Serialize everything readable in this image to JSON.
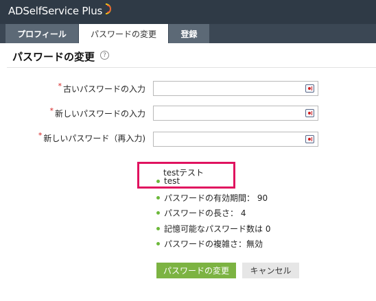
{
  "header": {
    "brand": "ADSelfService Plus"
  },
  "tabs": [
    {
      "label": "プロフィール"
    },
    {
      "label": "パスワードの変更"
    },
    {
      "label": "登録"
    }
  ],
  "page": {
    "title": "パスワードの変更",
    "help_icon": "?"
  },
  "form": {
    "required_mark": "*",
    "fields": [
      {
        "label": "古いパスワードの入力",
        "value": ""
      },
      {
        "label": "新しいパスワードの入力",
        "value": ""
      },
      {
        "label": "新しいパスワード（再入力)",
        "value": ""
      }
    ]
  },
  "policy": {
    "heading": "testテスト",
    "items": [
      "test",
      "パスワードの有効期間： 90",
      "パスワードの長さ： 4",
      "記憶可能なパスワード数は 0",
      "パスワードの複雑さ：無効"
    ],
    "bullet_color": "#6cb83a",
    "highlight_color": "#e0125f"
  },
  "buttons": {
    "change": "パスワードの変更",
    "cancel": "キャンセル"
  }
}
